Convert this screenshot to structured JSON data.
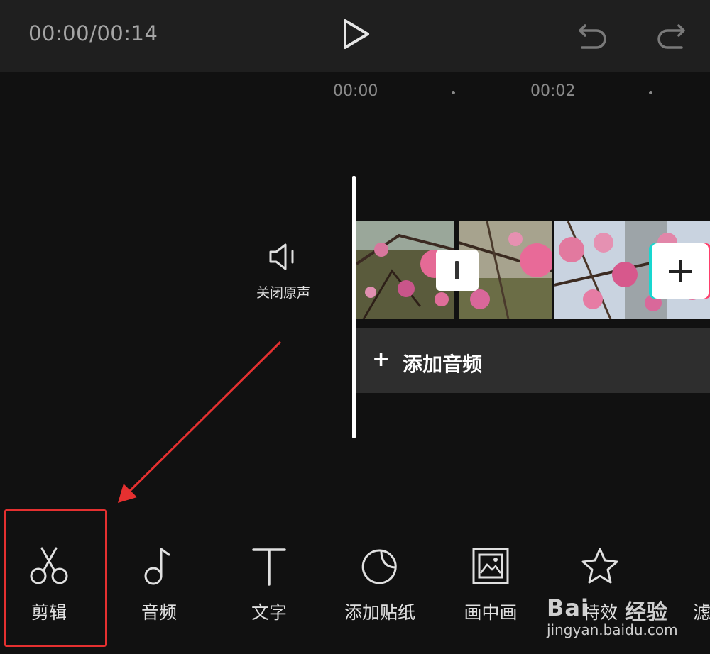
{
  "header": {
    "timecode": "00:00/00:14",
    "play_icon": "play-icon",
    "undo_icon": "undo-icon",
    "redo_icon": "redo-icon"
  },
  "ruler": {
    "labels": [
      "00:00",
      "00:02"
    ]
  },
  "timeline": {
    "mute_label": "关闭原声",
    "mute_icon": "speaker-icon",
    "transition_icon": "transition-icon",
    "add_clip_icon": "plus-icon",
    "add_audio_label": "添加音频",
    "add_audio_plus": "+"
  },
  "toolbar": {
    "items": [
      {
        "label": "剪辑",
        "icon": "scissors-icon"
      },
      {
        "label": "音频",
        "icon": "music-note-icon"
      },
      {
        "label": "文字",
        "icon": "text-icon"
      },
      {
        "label": "添加贴纸",
        "icon": "sticker-icon"
      },
      {
        "label": "画中画",
        "icon": "picture-in-picture-icon"
      },
      {
        "label": "特效",
        "icon": "star-effect-icon"
      },
      {
        "label": "滤",
        "icon": "filter-icon"
      }
    ]
  },
  "watermark": {
    "brand": "Bai",
    "brand_suffix": "经验",
    "url": "jingyan.baidu.com"
  },
  "colors": {
    "background": "#111111",
    "topbar": "#1f1f1f",
    "annotation_red": "#e53030",
    "accent_cyan": "#18d7d0",
    "accent_pink": "#ff3f6c"
  }
}
